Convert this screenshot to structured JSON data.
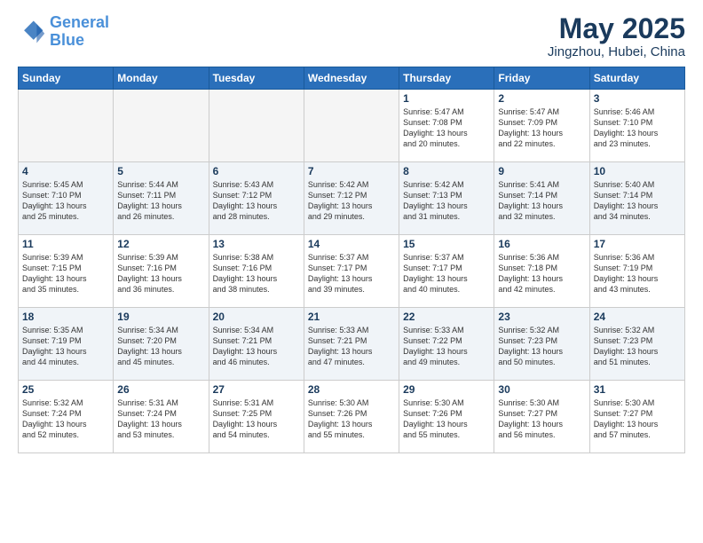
{
  "logo": {
    "line1": "General",
    "line2": "Blue"
  },
  "title": "May 2025",
  "location": "Jingzhou, Hubei, China",
  "days_of_week": [
    "Sunday",
    "Monday",
    "Tuesday",
    "Wednesday",
    "Thursday",
    "Friday",
    "Saturday"
  ],
  "weeks": [
    {
      "shaded": false,
      "days": [
        {
          "num": "",
          "content": ""
        },
        {
          "num": "",
          "content": ""
        },
        {
          "num": "",
          "content": ""
        },
        {
          "num": "",
          "content": ""
        },
        {
          "num": "1",
          "content": "Sunrise: 5:47 AM\nSunset: 7:08 PM\nDaylight: 13 hours\nand 20 minutes."
        },
        {
          "num": "2",
          "content": "Sunrise: 5:47 AM\nSunset: 7:09 PM\nDaylight: 13 hours\nand 22 minutes."
        },
        {
          "num": "3",
          "content": "Sunrise: 5:46 AM\nSunset: 7:10 PM\nDaylight: 13 hours\nand 23 minutes."
        }
      ]
    },
    {
      "shaded": true,
      "days": [
        {
          "num": "4",
          "content": "Sunrise: 5:45 AM\nSunset: 7:10 PM\nDaylight: 13 hours\nand 25 minutes."
        },
        {
          "num": "5",
          "content": "Sunrise: 5:44 AM\nSunset: 7:11 PM\nDaylight: 13 hours\nand 26 minutes."
        },
        {
          "num": "6",
          "content": "Sunrise: 5:43 AM\nSunset: 7:12 PM\nDaylight: 13 hours\nand 28 minutes."
        },
        {
          "num": "7",
          "content": "Sunrise: 5:42 AM\nSunset: 7:12 PM\nDaylight: 13 hours\nand 29 minutes."
        },
        {
          "num": "8",
          "content": "Sunrise: 5:42 AM\nSunset: 7:13 PM\nDaylight: 13 hours\nand 31 minutes."
        },
        {
          "num": "9",
          "content": "Sunrise: 5:41 AM\nSunset: 7:14 PM\nDaylight: 13 hours\nand 32 minutes."
        },
        {
          "num": "10",
          "content": "Sunrise: 5:40 AM\nSunset: 7:14 PM\nDaylight: 13 hours\nand 34 minutes."
        }
      ]
    },
    {
      "shaded": false,
      "days": [
        {
          "num": "11",
          "content": "Sunrise: 5:39 AM\nSunset: 7:15 PM\nDaylight: 13 hours\nand 35 minutes."
        },
        {
          "num": "12",
          "content": "Sunrise: 5:39 AM\nSunset: 7:16 PM\nDaylight: 13 hours\nand 36 minutes."
        },
        {
          "num": "13",
          "content": "Sunrise: 5:38 AM\nSunset: 7:16 PM\nDaylight: 13 hours\nand 38 minutes."
        },
        {
          "num": "14",
          "content": "Sunrise: 5:37 AM\nSunset: 7:17 PM\nDaylight: 13 hours\nand 39 minutes."
        },
        {
          "num": "15",
          "content": "Sunrise: 5:37 AM\nSunset: 7:17 PM\nDaylight: 13 hours\nand 40 minutes."
        },
        {
          "num": "16",
          "content": "Sunrise: 5:36 AM\nSunset: 7:18 PM\nDaylight: 13 hours\nand 42 minutes."
        },
        {
          "num": "17",
          "content": "Sunrise: 5:36 AM\nSunset: 7:19 PM\nDaylight: 13 hours\nand 43 minutes."
        }
      ]
    },
    {
      "shaded": true,
      "days": [
        {
          "num": "18",
          "content": "Sunrise: 5:35 AM\nSunset: 7:19 PM\nDaylight: 13 hours\nand 44 minutes."
        },
        {
          "num": "19",
          "content": "Sunrise: 5:34 AM\nSunset: 7:20 PM\nDaylight: 13 hours\nand 45 minutes."
        },
        {
          "num": "20",
          "content": "Sunrise: 5:34 AM\nSunset: 7:21 PM\nDaylight: 13 hours\nand 46 minutes."
        },
        {
          "num": "21",
          "content": "Sunrise: 5:33 AM\nSunset: 7:21 PM\nDaylight: 13 hours\nand 47 minutes."
        },
        {
          "num": "22",
          "content": "Sunrise: 5:33 AM\nSunset: 7:22 PM\nDaylight: 13 hours\nand 49 minutes."
        },
        {
          "num": "23",
          "content": "Sunrise: 5:32 AM\nSunset: 7:23 PM\nDaylight: 13 hours\nand 50 minutes."
        },
        {
          "num": "24",
          "content": "Sunrise: 5:32 AM\nSunset: 7:23 PM\nDaylight: 13 hours\nand 51 minutes."
        }
      ]
    },
    {
      "shaded": false,
      "days": [
        {
          "num": "25",
          "content": "Sunrise: 5:32 AM\nSunset: 7:24 PM\nDaylight: 13 hours\nand 52 minutes."
        },
        {
          "num": "26",
          "content": "Sunrise: 5:31 AM\nSunset: 7:24 PM\nDaylight: 13 hours\nand 53 minutes."
        },
        {
          "num": "27",
          "content": "Sunrise: 5:31 AM\nSunset: 7:25 PM\nDaylight: 13 hours\nand 54 minutes."
        },
        {
          "num": "28",
          "content": "Sunrise: 5:30 AM\nSunset: 7:26 PM\nDaylight: 13 hours\nand 55 minutes."
        },
        {
          "num": "29",
          "content": "Sunrise: 5:30 AM\nSunset: 7:26 PM\nDaylight: 13 hours\nand 55 minutes."
        },
        {
          "num": "30",
          "content": "Sunrise: 5:30 AM\nSunset: 7:27 PM\nDaylight: 13 hours\nand 56 minutes."
        },
        {
          "num": "31",
          "content": "Sunrise: 5:30 AM\nSunset: 7:27 PM\nDaylight: 13 hours\nand 57 minutes."
        }
      ]
    }
  ]
}
